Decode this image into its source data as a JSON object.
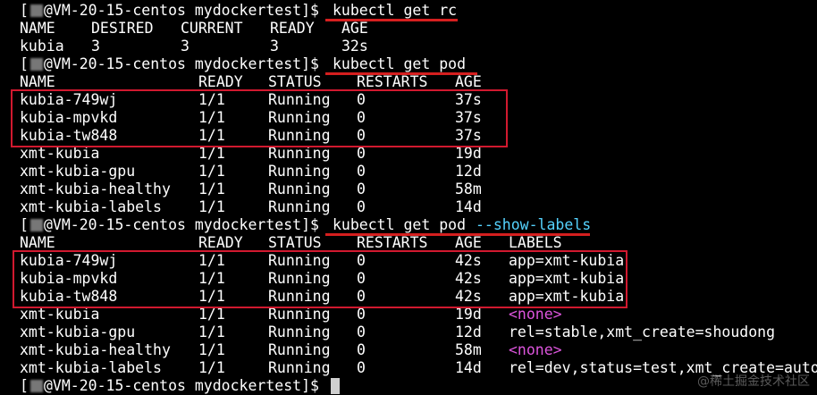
{
  "prompt": "@VM-20-15-centos mydockertest]$",
  "prompt_prefix": "[",
  "commands": {
    "c1": "kubectl get rc",
    "c2": "kubectl get pod",
    "c3_base": "kubectl get pod",
    "c3_flag": "--show-labels"
  },
  "rc": {
    "headers": [
      "NAME",
      "DESIRED",
      "CURRENT",
      "READY",
      "AGE"
    ],
    "row": [
      "kubia",
      "3",
      "3",
      "3",
      "32s"
    ]
  },
  "pods1": {
    "headers": [
      "NAME",
      "READY",
      "STATUS",
      "RESTARTS",
      "AGE"
    ],
    "rows": [
      [
        "kubia-749wj",
        "1/1",
        "Running",
        "0",
        "37s"
      ],
      [
        "kubia-mpvkd",
        "1/1",
        "Running",
        "0",
        "37s"
      ],
      [
        "kubia-tw848",
        "1/1",
        "Running",
        "0",
        "37s"
      ],
      [
        "xmt-kubia",
        "1/1",
        "Running",
        "0",
        "19d"
      ],
      [
        "xmt-kubia-gpu",
        "1/1",
        "Running",
        "0",
        "12d"
      ],
      [
        "xmt-kubia-healthy",
        "1/1",
        "Running",
        "0",
        "58m"
      ],
      [
        "xmt-kubia-labels",
        "1/1",
        "Running",
        "0",
        "14d"
      ]
    ]
  },
  "pods2": {
    "headers": [
      "NAME",
      "READY",
      "STATUS",
      "RESTARTS",
      "AGE",
      "LABELS"
    ],
    "rows": [
      [
        "kubia-749wj",
        "1/1",
        "Running",
        "0",
        "42s",
        "app=xmt-kubia"
      ],
      [
        "kubia-mpvkd",
        "1/1",
        "Running",
        "0",
        "42s",
        "app=xmt-kubia"
      ],
      [
        "kubia-tw848",
        "1/1",
        "Running",
        "0",
        "42s",
        "app=xmt-kubia"
      ],
      [
        "xmt-kubia",
        "1/1",
        "Running",
        "0",
        "19d",
        "<none>"
      ],
      [
        "xmt-kubia-gpu",
        "1/1",
        "Running",
        "0",
        "12d",
        "rel=stable,xmt_create=shoudong"
      ],
      [
        "xmt-kubia-healthy",
        "1/1",
        "Running",
        "0",
        "58m",
        "<none>"
      ],
      [
        "xmt-kubia-labels",
        "1/1",
        "Running",
        "0",
        "14d",
        "rel=dev,status=test,xmt_create=auto"
      ]
    ]
  },
  "watermark": "@稀土掘金技术社区",
  "colors": {
    "highlight": "#d1192f",
    "flag": "#55d3ff",
    "none_label": "#dd55dd"
  }
}
